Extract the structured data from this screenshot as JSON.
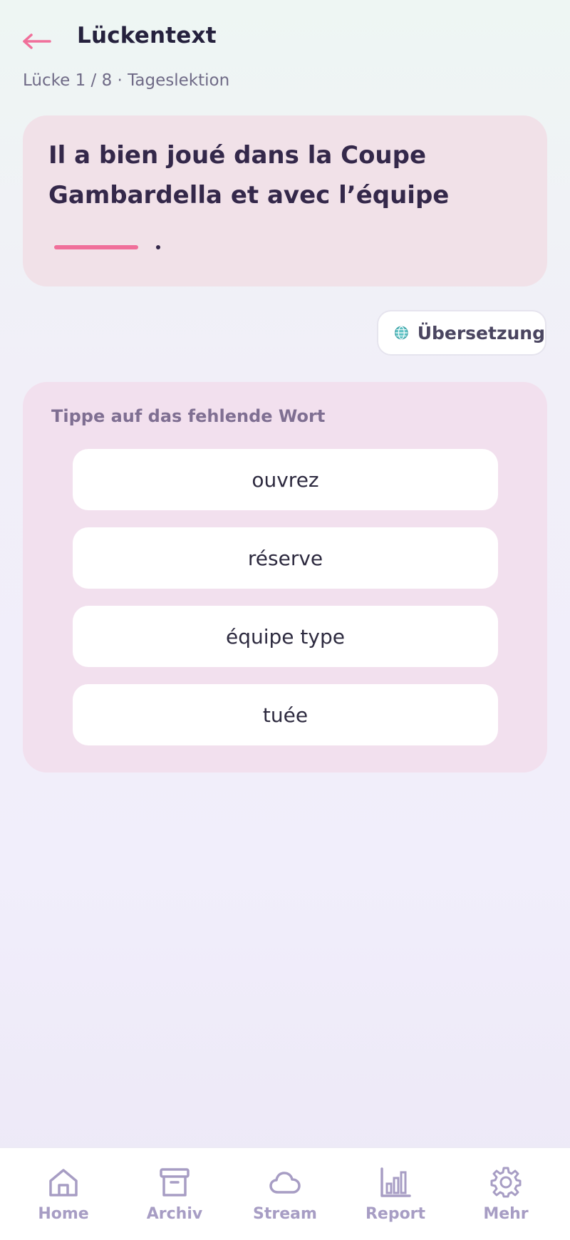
{
  "header": {
    "back_icon": "arrow-left-icon",
    "title": "Lückentext",
    "subtitle": "Lücke 1 / 8 · Tageslektion"
  },
  "sentence": {
    "line1": "Il a bien joué dans la Coupe",
    "line2": "Gambardella et avec l’équipe"
  },
  "translate": {
    "icon": "globe-icon",
    "label": "Übersetzung"
  },
  "options": {
    "label": "Tippe auf das fehlende Wort",
    "items": [
      "ouvrez",
      "réserve",
      "équipe type",
      "tuée"
    ]
  },
  "nav": {
    "items": [
      {
        "label": "Home",
        "icon": "home-icon"
      },
      {
        "label": "Archiv",
        "icon": "archive-icon"
      },
      {
        "label": "Stream",
        "icon": "cloud-icon"
      },
      {
        "label": "Report",
        "icon": "bar-chart-icon"
      },
      {
        "label": "Mehr",
        "icon": "gear-icon"
      }
    ]
  },
  "colors": {
    "accent": "#f06f9a",
    "nav_icon": "#a79dc4",
    "title": "#25213d"
  }
}
